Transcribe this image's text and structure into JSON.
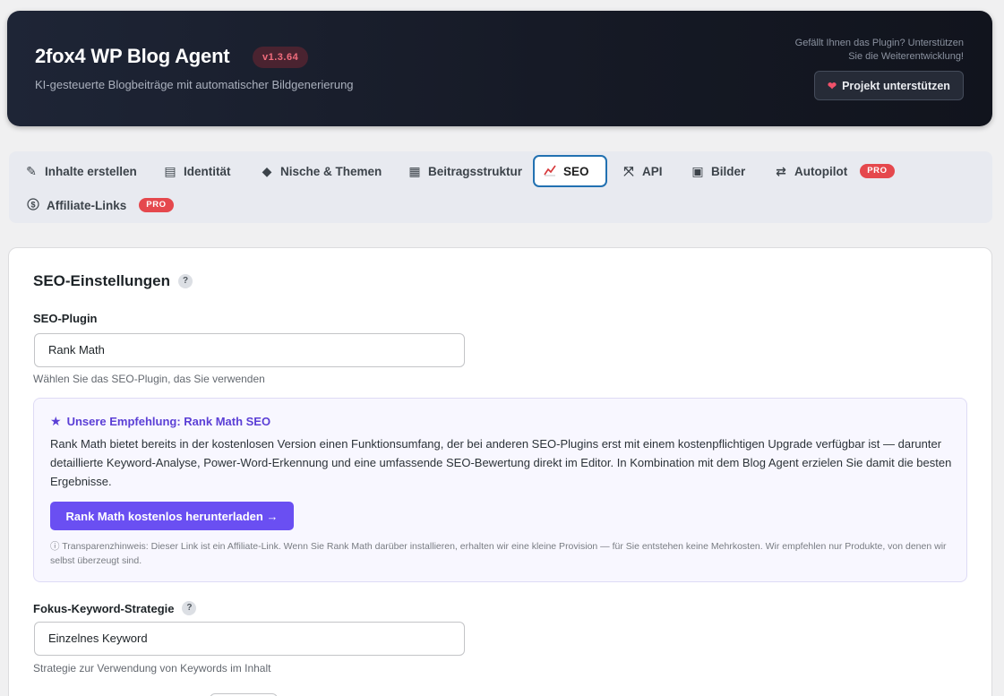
{
  "header": {
    "title": "2fox4 WP Blog Agent",
    "version": "v1.3.64",
    "subtitle": "KI-gesteuerte Blogbeiträge mit automatischer Bildgenerierung",
    "support_text_line1": "Gefällt Ihnen das Plugin? Unterstützen",
    "support_text_line2": "Sie die Weiterentwicklung!",
    "support_button": "Projekt unterstützen",
    "support_icon": "heart-icon"
  },
  "tabs": [
    {
      "label": "Inhalte erstellen",
      "icon": "edit-icon",
      "glyph": "✎"
    },
    {
      "label": "Identität",
      "icon": "id-card-icon",
      "glyph": "▤"
    },
    {
      "label": "Nische & Themen",
      "icon": "tag-icon",
      "glyph": "◆"
    },
    {
      "label": "Beitragsstruktur",
      "icon": "table-icon",
      "glyph": "▦"
    },
    {
      "label": "SEO",
      "icon": "chart-line-icon",
      "glyph": "📈",
      "active": true
    },
    {
      "label": "API",
      "icon": "network-icon",
      "glyph": "⤧"
    },
    {
      "label": "Bilder",
      "icon": "image-icon",
      "glyph": "▣"
    },
    {
      "label": "Autopilot",
      "icon": "repeat-icon",
      "glyph": "⇄",
      "badge": "PRO"
    },
    {
      "label": "Affiliate-Links",
      "icon": "dollar-circle-icon",
      "glyph": "$",
      "badge": "PRO"
    }
  ],
  "seo": {
    "section_title": "SEO-Einstellungen",
    "help_glyph": "?",
    "plugin_label": "SEO-Plugin",
    "plugin_value": "Rank Math",
    "plugin_hint": "Wählen Sie das SEO-Plugin, das Sie verwenden",
    "recommendation": {
      "title": "Unsere Empfehlung: Rank Math SEO",
      "body": "Rank Math bietet bereits in der kostenlosen Version einen Funktionsumfang, der bei anderen SEO-Plugins erst mit einem kostenpflichtigen Upgrade verfügbar ist — darunter detaillierte Keyword-Analyse, Power-Word-Erkennung und eine umfassende SEO-Bewertung direkt im Editor. In Kombination mit dem Blog Agent erzielen Sie damit die besten Ergebnisse.",
      "button": "Rank Math kostenlos herunterladen →",
      "note": "ⓘ  Transparenzhinweis: Dieser Link ist ein Affiliate-Link. Wenn Sie Rank Math darüber installieren, erhalten wir eine kleine Provision — für Sie entstehen keine Mehrkosten. Wir empfehlen nur Produkte, von denen wir selbst überzeugt sind."
    },
    "keyword_label": "Fokus-Keyword-Strategie",
    "keyword_value": "Einzelnes Keyword",
    "keyword_hint": "Strategie zur Verwendung von Keywords im Inhalt"
  },
  "colors": {
    "accent_active": "#2271b1",
    "pro_badge": "#e5484d",
    "recommend_purple": "#6a4ff2"
  }
}
